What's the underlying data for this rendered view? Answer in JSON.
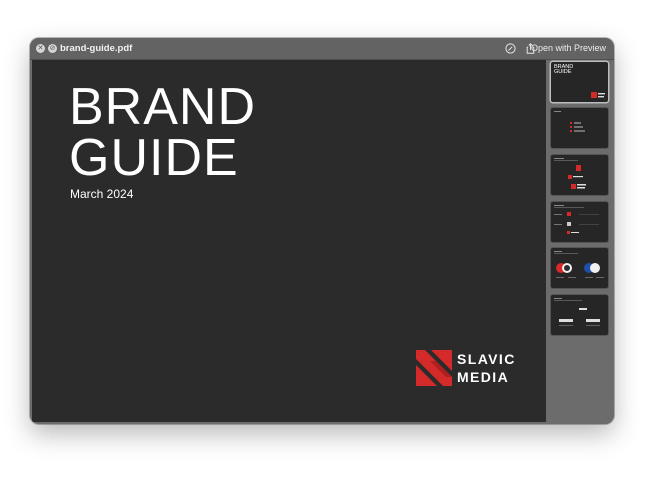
{
  "window": {
    "title": "brand-guide.pdf",
    "open_with_label": "Open with Preview"
  },
  "icons": {
    "close": "close-icon",
    "block": "block-icon",
    "markup": "markup-icon",
    "share": "share-icon"
  },
  "document": {
    "title_line1": "BRAND",
    "title_line2": "GUIDE",
    "date": "March 2024",
    "logo_line1": "SLAVIC",
    "logo_line2": "MEDIA",
    "brand_red": "#d42a2a",
    "page_bg": "#2b2b2b"
  },
  "thumbnails": {
    "count": 6,
    "selected_index": 1,
    "thumb1_title_line1": "BRAND",
    "thumb1_title_line2": "GUIDE"
  }
}
